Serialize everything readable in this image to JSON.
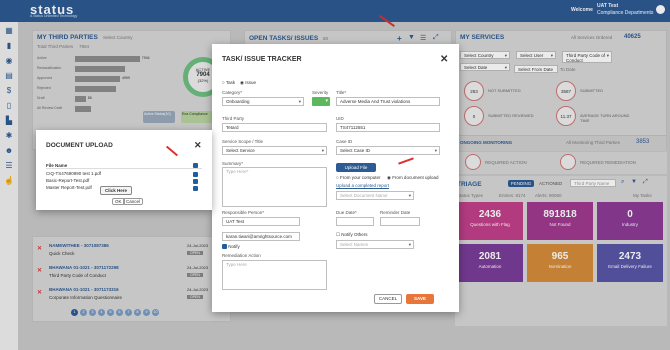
{
  "header": {
    "logo": "status",
    "tagline": "A Status Unlimited Technology",
    "welcome": "Welcome",
    "user_name": "UAT Test",
    "user_dept": "Compliance Departments"
  },
  "third_parties": {
    "title": "MY THIRD PARTIES",
    "filter": "Select Country",
    "total_label": "Total Third Parties",
    "total_value": "7904",
    "active_label": "ACTIVE",
    "active_value": "7904",
    "active_pct": "(32%)",
    "bars": [
      {
        "label": "Active",
        "value": "7904",
        "fill": 0.72,
        "color": "#8c8c8c"
      },
      {
        "label": "Reclassification",
        "value": "",
        "fill": 0.55,
        "color": "#8c8c8c"
      },
      {
        "label": "Approved",
        "value": "4999",
        "fill": 0.5,
        "color": "#8c8c8c"
      },
      {
        "label": "Rejected",
        "value": "",
        "fill": 0.45,
        "color": "#8c8c8c"
      },
      {
        "label": "Draft",
        "value": "85",
        "fill": 0.12,
        "color": "#8c8c8c"
      },
      {
        "label": "All Review Draft",
        "value": "",
        "fill": 0.18,
        "color": "#8c8c8c"
      }
    ],
    "bubble_a": "Active Status(10)",
    "bubble_b": "Ena Compliance"
  },
  "open_tasks": {
    "title": "OPEN TASKS/ ISSUES",
    "count": "50",
    "rows": [
      {
        "name": "NAMEWITHEE - 3071087386",
        "desc": "Quick Check",
        "date": "24-Jul-2023"
      },
      {
        "name": "BHAWANA 01-1021 - 3071172298",
        "desc": "Third Party Code of Conduct",
        "date": "24-Jul-2023"
      },
      {
        "name": "BHAWANA 01-1021 - 3071173316",
        "desc": "Corporate Information Questionnaire",
        "date": "24-Jul-2023"
      }
    ],
    "status": "OPEN",
    "pages": [
      "1",
      "2",
      "3",
      "4",
      "5",
      "6",
      "7",
      "8",
      "9",
      "10"
    ]
  },
  "services": {
    "title": "MY SERVICES",
    "all_services_label": "All Services Ordered",
    "all_services_value": "40625",
    "country": "Select Country",
    "user": "Select User",
    "code": "Third Party Code of Conduct",
    "date": "Select Date",
    "from": "Select From Date",
    "to": "To Date",
    "circles": [
      {
        "value": "253",
        "label": "NOT SUBMITTED"
      },
      {
        "value": "3587",
        "label": "SUBMITTED"
      },
      {
        "value": "0",
        "label": "SUBMITTED REVIEWED"
      },
      {
        "value": "11.37",
        "label": "AVERAGE TURN AROUND TIME"
      }
    ],
    "monitoring": "ONGOING MONITORING",
    "monitoring_sub": "All Monitoring Third Parties",
    "monitoring_value": "3853",
    "req_action": "REQUIRED ACTION",
    "req_remediation": "REQUIRED REMEDIATION"
  },
  "triage": {
    "title": "TRIAGE",
    "tab_pending": "PENDING",
    "tab_actioned": "ACTIONED",
    "tp_placeholder": "Third Party Name",
    "status_types": "Status Types",
    "entries": "Entries: 8174",
    "alerts": "Alerts: 90060",
    "my_tasks": "My Tasks",
    "tiles": [
      {
        "value": "2436",
        "label": "Questions with Flag",
        "color": "#c2418b"
      },
      {
        "value": "891818",
        "label": "Not Found",
        "color": "#a13a8f"
      },
      {
        "value": "0",
        "label": "Industry",
        "color": "#8c3b96"
      },
      {
        "value": "2081",
        "label": "Automation",
        "color": "#7a3d98"
      },
      {
        "value": "965",
        "label": "Nomination",
        "color": "#d58d3b"
      },
      {
        "value": "2473",
        "label": "Email Delivery Failure",
        "color": "#5a56a8"
      }
    ]
  },
  "task_modal": {
    "title": "TASK/ ISSUE TRACKER",
    "opt_task": "Task",
    "opt_issue": "Issue",
    "category_label": "Category*",
    "category_value": "Onboarding",
    "severity_label": "Severity",
    "title_label": "Title*",
    "title_value": "Adverse Media And Trust violations",
    "third_party_label": "Third Party",
    "third_party_value": "Tetard",
    "uid_label": "UID",
    "uid_value": "TS47112551",
    "service_type_label": "Service Scope / Title",
    "service_type_value": "Select Service",
    "case_label": "Case ID",
    "case_value": "Select Case ID",
    "summary_label": "Summary*",
    "summary_placeholder": "Type Here*",
    "upload_button": "Upload File",
    "from_computer": "From your computer",
    "from_upload": "From document upload",
    "upload_link": "Upload a completed report",
    "doc_placeholder": "Select Document Name",
    "responsible_label": "Responsible Person*",
    "responsible_value": "UAT Test",
    "responsible_email": "karan.tiwari@amrightsource.com",
    "notify": "Notify",
    "due_label": "Due Date*",
    "reminder_label": "Reminder Date",
    "notify_others": "Notify Others",
    "notify_placeholder": "Select Names",
    "remediation_label": "Remediation Action",
    "remediation_placeholder": "Type Here",
    "cancel": "CANCEL",
    "save": "SAVE"
  },
  "doc_modal": {
    "title": "DOCUMENT UPLOAD",
    "file_header": "File Name",
    "files": [
      "CIQ-TS47690990 test 1.pdf",
      "Basic-Report-Test.pdf",
      "Master Report-Test.pdf"
    ],
    "tooltip": "Click Here",
    "ok": "OK",
    "cancel": "Cancel"
  }
}
